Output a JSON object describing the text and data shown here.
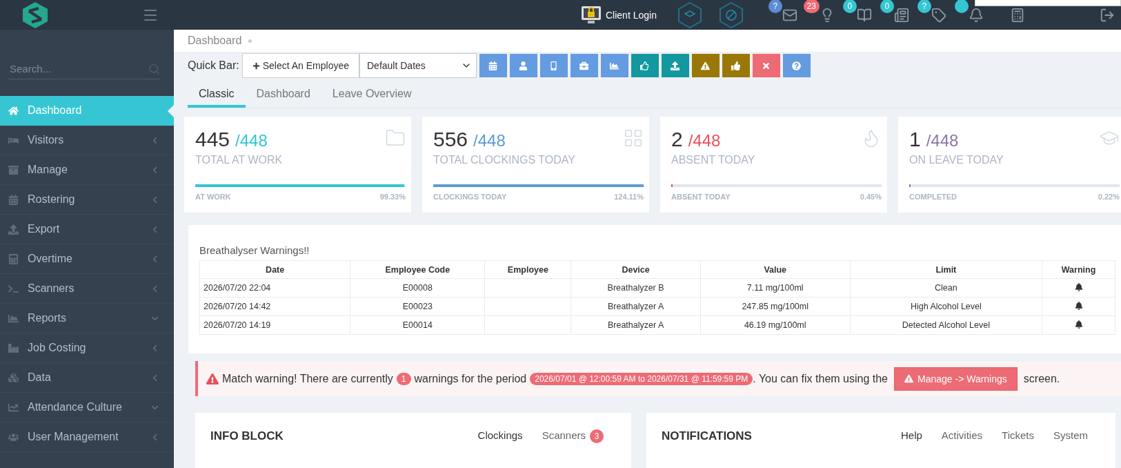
{
  "header": {
    "client_login": "Client Login",
    "icons": [
      {
        "badge": "?",
        "color": "#5b8dd6"
      },
      {
        "badge": "23",
        "color": "#ed6b75"
      },
      {
        "badge": "0",
        "color": "#36c6d3"
      },
      {
        "badge": "0",
        "color": "#36c6d3"
      },
      {
        "badge": "?",
        "color": "#36c6d3"
      },
      {
        "color": "#36c6d3"
      }
    ]
  },
  "sidebar": {
    "search": {
      "placeholder": "Search..."
    },
    "items": [
      {
        "label": "Dashboard",
        "selected": true
      },
      {
        "label": "Visitors",
        "selected": false,
        "expanded": false
      },
      {
        "label": "Manage",
        "selected": false,
        "expanded": false
      },
      {
        "label": "Rostering",
        "selected": false,
        "expanded": false
      },
      {
        "label": "Export",
        "selected": false,
        "expanded": false
      },
      {
        "label": "Overtime",
        "selected": false,
        "expanded": false
      },
      {
        "label": "Scanners",
        "selected": false,
        "expanded": false
      },
      {
        "label": "Reports",
        "selected": false,
        "expanded": true
      },
      {
        "label": "Job Costing",
        "selected": false,
        "expanded": false
      },
      {
        "label": "Data",
        "selected": false,
        "expanded": false
      },
      {
        "label": "Attendance Culture",
        "selected": false,
        "expanded": true
      },
      {
        "label": "User Management",
        "selected": false,
        "expanded": false
      }
    ]
  },
  "breadcrumb": "Dashboard",
  "quick_bar": {
    "label": "Quick Bar:",
    "employee_button": "Select An Employee",
    "dates": "Default Dates",
    "buttons": [
      {
        "color": "#659be0"
      },
      {
        "color": "#659be0"
      },
      {
        "color": "#659be0"
      },
      {
        "color": "#659be0"
      },
      {
        "color": "#659be0"
      },
      {
        "color": "#14989f"
      },
      {
        "color": "#14989f"
      },
      {
        "color": "#9a7807"
      },
      {
        "color": "#9a7807"
      },
      {
        "color": "#ed6b75"
      },
      {
        "color": "#659be0"
      }
    ]
  },
  "tabs": [
    {
      "label": "Classic",
      "selected": true
    },
    {
      "label": "Dashboard",
      "selected": false
    },
    {
      "label": "Leave Overview",
      "selected": false
    }
  ],
  "stats": [
    {
      "value": "445",
      "total": "/448",
      "title": "TOTAL AT WORK",
      "footer": "AT WORK",
      "percent": "99.33%",
      "level": 0.9933,
      "color": "#32c5d2"
    },
    {
      "value": "556",
      "total": "/448",
      "title": "TOTAL CLOCKINGS TODAY",
      "footer": "CLOCKINGS TODAY",
      "percent": "124.11%",
      "level": 1,
      "color": "#5c9bd1"
    },
    {
      "value": "2",
      "total": "/448",
      "title": "ABSENT TODAY",
      "footer": "ABSENT TODAY",
      "percent": "0.45%",
      "level": 0.0045,
      "color": "#e7505a"
    },
    {
      "value": "1",
      "total": "/448",
      "title": "ON LEAVE TODAY",
      "footer": "COMPLETED",
      "percent": "0.22%",
      "level": 0.0022,
      "color": "#8877a9"
    }
  ],
  "breathalyser": {
    "title": "Breathalyser Warnings!!",
    "columns": [
      "Date",
      "Employee Code",
      "Employee",
      "Device",
      "Value",
      "Limit",
      "Warning"
    ],
    "rows": [
      {
        "date": "2026/07/20 22:04",
        "code": "E00008",
        "device": "Breathalyzer B",
        "value": "7.11 mg/100ml",
        "limit": "Clean"
      },
      {
        "date": "2026/07/20 14:42",
        "code": "E00023",
        "device": "Breathalyzer A",
        "value": "247.85 mg/100ml",
        "limit": "High Alcohol Level"
      },
      {
        "date": "2026/07/20 14:19",
        "code": "E00014",
        "device": "Breathalyzer A",
        "value": "46.19 mg/100ml",
        "limit": "Detected Alcohol Level"
      }
    ]
  },
  "alert": {
    "text_1": "Match warning! There are currently",
    "count": "1",
    "text_2": "warnings for the period",
    "period": "2026/07/01 @ 12:00:59 AM to 2026/07/31 @ 11:59:59 PM",
    "text_3": ". You can fix them using the",
    "button": "Manage -> Warnings",
    "text_4": "screen."
  },
  "info_block": {
    "title": "INFO BLOCK",
    "tabs": [
      {
        "label": "Clockings",
        "selected": true
      },
      {
        "label": "Scanners",
        "selected": false,
        "badge": "3"
      }
    ]
  },
  "notifications": {
    "title": "NOTIFICATIONS",
    "tabs": [
      {
        "label": "Help",
        "selected": true
      },
      {
        "label": "Activities",
        "selected": false
      },
      {
        "label": "Tickets",
        "selected": false
      },
      {
        "label": "System",
        "selected": false
      }
    ]
  }
}
